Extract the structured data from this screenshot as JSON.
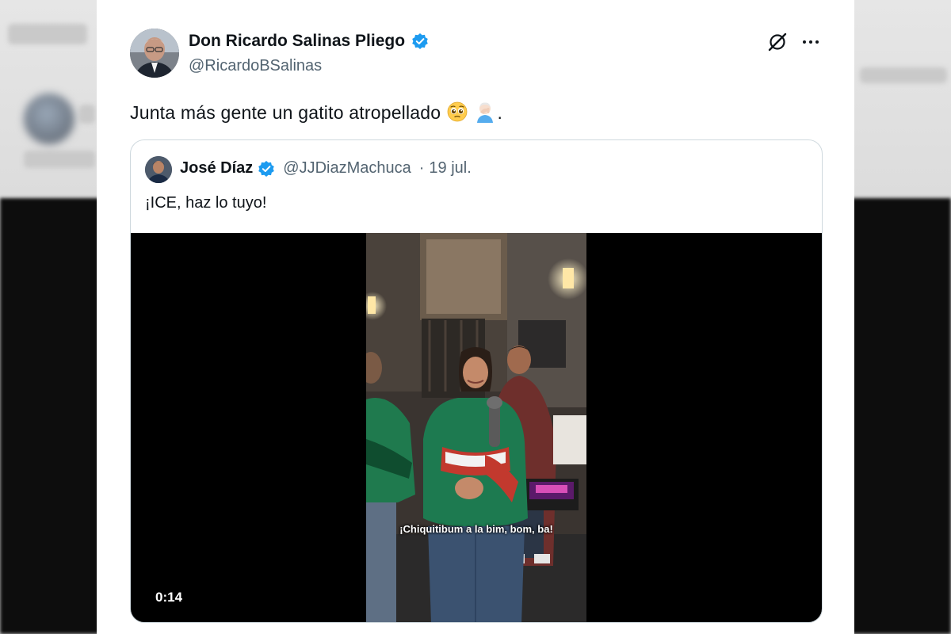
{
  "tweet": {
    "author_name": "Don Ricardo Salinas Pliego",
    "author_handle": "@RicardoBSalinas",
    "text": "Junta más gente un gatito atropellado",
    "text_emojis": [
      "pleading-face-emoji",
      "facepalm-emoji"
    ],
    "text_suffix": "."
  },
  "quoted_tweet": {
    "author_name": "José Díaz",
    "author_handle": "@JJDiazMachuca",
    "separator": "·",
    "date": "19 jul.",
    "text": "¡ICE, haz lo tuyo!",
    "video": {
      "subtitle": "¡Chiquitibum a la bim, bom, ba!",
      "duration": "0:14"
    }
  },
  "icons": {
    "verified": "verified-badge-icon",
    "grok": "grok-icon",
    "more": "more-options-icon"
  },
  "colors": {
    "verified_blue": "#1d9bf0",
    "text_primary": "#0f1419",
    "text_secondary": "#536471",
    "border": "#cfd9de"
  }
}
